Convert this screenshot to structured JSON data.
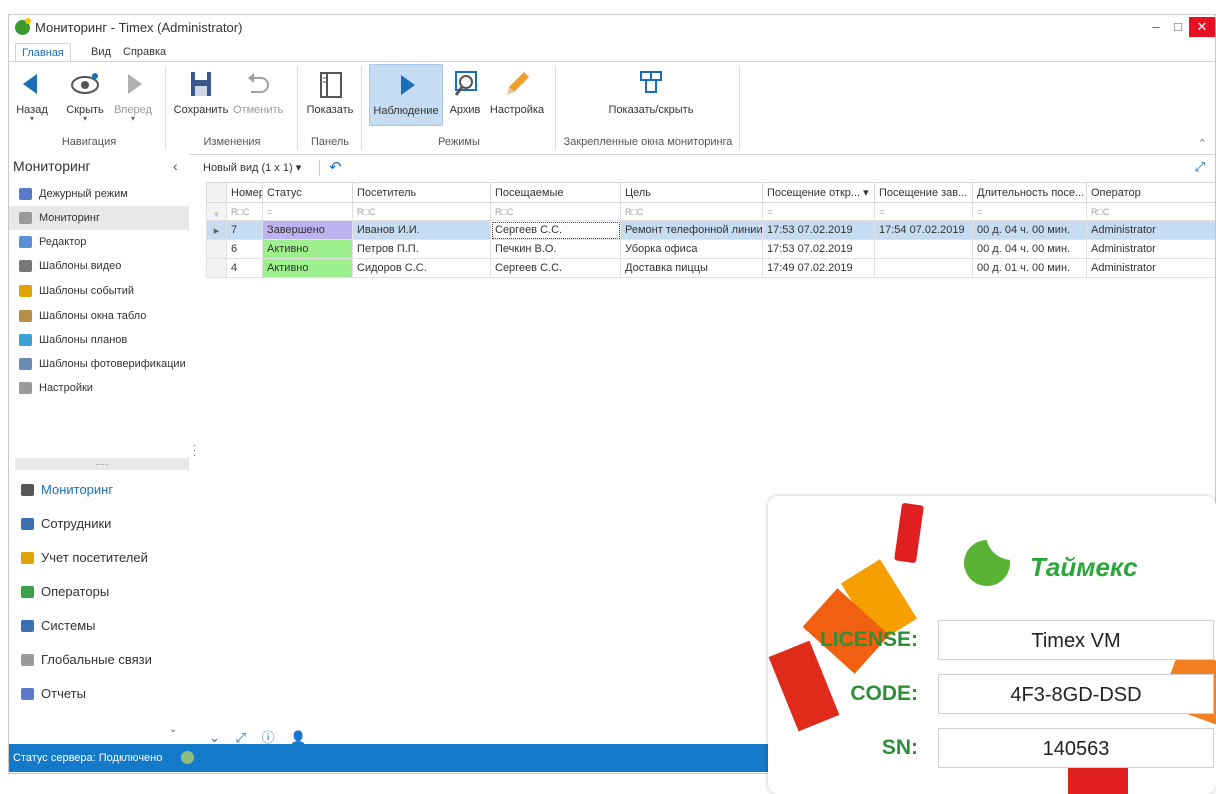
{
  "window": {
    "title": "Мониторинг - Timex (Administrator)",
    "minimize": "–",
    "maximize": "□",
    "close": "✕"
  },
  "menu": {
    "tabs": [
      "Главная",
      "Вид",
      "Справка"
    ]
  },
  "ribbon": {
    "buttons": {
      "back": "Назад",
      "hide": "Скрыть",
      "forward": "Вперед",
      "save": "Сохранить",
      "cancel": "Отменить",
      "show": "Показать",
      "observe": "Наблюдение",
      "archive": "Архив",
      "settings": "Настройка",
      "showhide": "Показать/скрыть"
    },
    "groups": {
      "navigation": "Навигация",
      "changes": "Изменения",
      "panel": "Панель",
      "modes": "Режимы",
      "pinned": "Закрепленные окна мониторинга"
    }
  },
  "sidebar": {
    "title": "Мониторинг",
    "items": [
      {
        "label": "Дежурный режим",
        "icon": "shield-icon",
        "color": "#5b79c9"
      },
      {
        "label": "Мониторинг",
        "icon": "shield-check-icon",
        "color": "#9a9a9a"
      },
      {
        "label": "Редактор",
        "icon": "edit-icon",
        "color": "#5b8fd6"
      },
      {
        "label": "Шаблоны видео",
        "icon": "camera-icon",
        "color": "#777777"
      },
      {
        "label": "Шаблоны событий",
        "icon": "events-icon",
        "color": "#e0a400"
      },
      {
        "label": "Шаблоны окна табло",
        "icon": "board-icon",
        "color": "#b98c4a"
      },
      {
        "label": "Шаблоны планов",
        "icon": "map-icon",
        "color": "#3aa0d6"
      },
      {
        "label": "Шаблоны фотоверификации",
        "icon": "photo-icon",
        "color": "#6a8ab0"
      },
      {
        "label": "Настройки",
        "icon": "settings-icon",
        "color": "#9a9a9a"
      }
    ],
    "split": "......",
    "nav": [
      {
        "label": "Мониторинг",
        "icon": "monitor-icon",
        "color": "#555555"
      },
      {
        "label": "Сотрудники",
        "icon": "employees-icon",
        "color": "#3a6fb0"
      },
      {
        "label": "Учет посетителей",
        "icon": "visitors-icon",
        "color": "#e0a400"
      },
      {
        "label": "Операторы",
        "icon": "operators-icon",
        "color": "#3aa04a"
      },
      {
        "label": "Системы",
        "icon": "systems-icon",
        "color": "#3a6fb0"
      },
      {
        "label": "Глобальные связи",
        "icon": "link-icon",
        "color": "#9a9a9a"
      },
      {
        "label": "Отчеты",
        "icon": "reports-icon",
        "color": "#5b79c9"
      }
    ],
    "more": "⌄"
  },
  "toolbar": {
    "view": "Новый вид (1 x 1) ▾"
  },
  "table": {
    "columns": [
      "Номер",
      "Статус",
      "Посетитель",
      "Посещаемые",
      "Цель",
      "Посещение откр... ▾",
      "Посещение зав...",
      "Длительность посе...",
      "Оператор"
    ],
    "filters": [
      "R□C",
      "=",
      "R□C",
      "R□C",
      "R□C",
      "=",
      "=",
      "=",
      "R□C"
    ],
    "rows": [
      {
        "num": "7",
        "status": "Завершено",
        "visitor": "Иванов И.И.",
        "host": "Сергеев С.С.",
        "purpose": "Ремонт телефонной линии",
        "opened": "17:53 07.02.2019",
        "closed": "17:54 07.02.2019",
        "duration": "00 д. 04 ч. 00 мин.",
        "operator": "Administrator"
      },
      {
        "num": "6",
        "status": "Активно",
        "visitor": "Петров П.П.",
        "host": "Печкин В.О.",
        "purpose": "Уборка офиса",
        "opened": "17:53 07.02.2019",
        "closed": "",
        "duration": "00 д. 04 ч. 00 мин.",
        "operator": "Administrator"
      },
      {
        "num": "4",
        "status": "Активно",
        "visitor": "Сидоров С.С.",
        "host": "Сергеев С.С.",
        "purpose": "Доставка пиццы",
        "opened": "17:49 07.02.2019",
        "closed": "",
        "duration": "00 д. 01 ч. 00 мин.",
        "operator": "Administrator"
      }
    ]
  },
  "status": {
    "text": "Статус сервера: Подключено"
  },
  "license": {
    "brand": "Таймекс",
    "license_label": "LICENSE:",
    "license_value": "Timex VM",
    "code_label": "CODE:",
    "code_value": "4F3-8GD-DSD",
    "sn_label": "SN:",
    "sn_value": "140563"
  }
}
